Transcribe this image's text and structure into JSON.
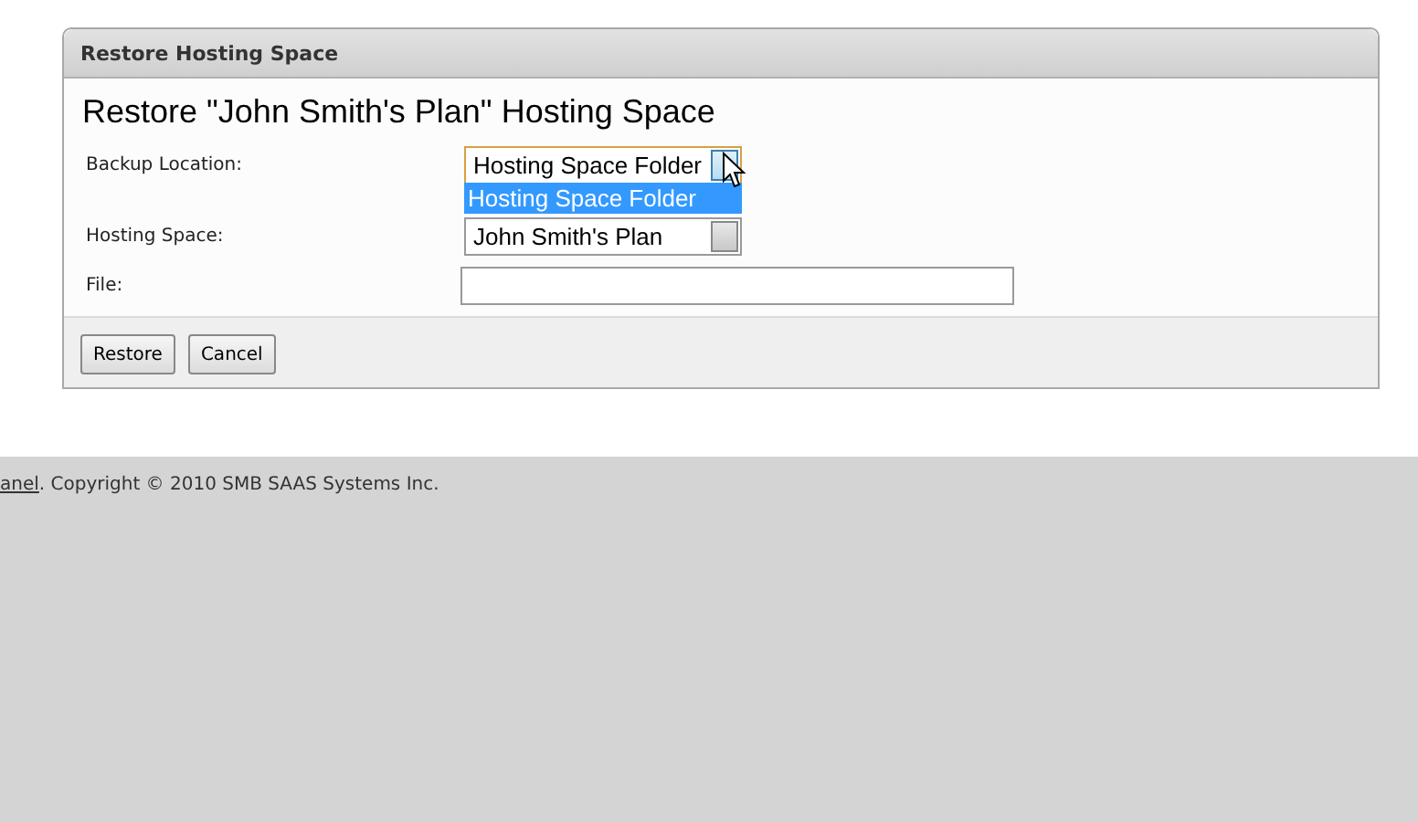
{
  "panel": {
    "header": "Restore Hosting Space",
    "title": "Restore \"John Smith's Plan\" Hosting Space",
    "fields": [
      {
        "kind": "select",
        "label": "Backup Location:",
        "value": "Hosting Space Folder",
        "focused": true,
        "options": [
          {
            "label": "Hosting Space Folder",
            "selected": true
          }
        ]
      },
      {
        "kind": "select",
        "label": "Hosting Space:",
        "value": "John Smith's Plan",
        "focused": false
      },
      {
        "kind": "text",
        "label": "File:"
      }
    ],
    "buttons": [
      "Restore",
      "Cancel"
    ]
  },
  "footer": {
    "link": "anel",
    "text": ". Copyright © 2010 SMB SAAS Systems Inc."
  }
}
